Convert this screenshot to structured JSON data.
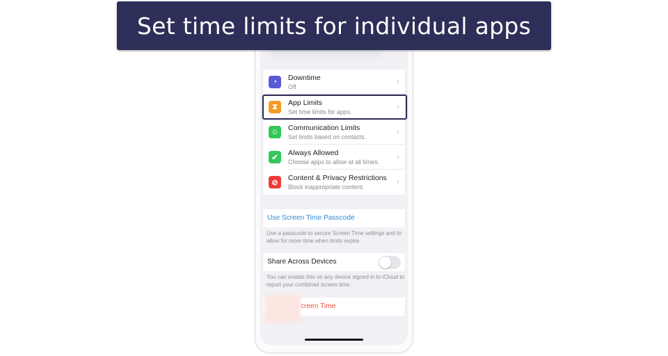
{
  "banner": {
    "title": "Set time limits for individual apps"
  },
  "colors": {
    "banner_bg": "#2e2f58",
    "link_blue": "#2f87d8",
    "destructive_red": "#e8553f"
  },
  "settings_group": [
    {
      "title": "Downtime",
      "subtitle": "Off",
      "icon": "downtime-icon",
      "icon_color": "#5b5ad6",
      "glyph": "◔"
    },
    {
      "title": "App Limits",
      "subtitle": "Set time limits for apps.",
      "icon": "hourglass-icon",
      "icon_color": "#f59a23",
      "glyph": "⧗",
      "highlighted": true
    },
    {
      "title": "Communication Limits",
      "subtitle": "Set limits based on contacts.",
      "icon": "contacts-icon",
      "icon_color": "#34c759",
      "glyph": "☺"
    },
    {
      "title": "Always Allowed",
      "subtitle": "Choose apps to allow at all times.",
      "icon": "checkmark-icon",
      "icon_color": "#34c759",
      "glyph": "✔"
    },
    {
      "title": "Content & Privacy Restrictions",
      "subtitle": "Block inappropriate content.",
      "icon": "restriction-icon",
      "icon_color": "#ef3b36",
      "glyph": "⊘"
    }
  ],
  "passcode": {
    "label": "Use Screen Time Passcode",
    "footnote": "Use a passcode to secure Screen Time settings and to allow for more time when limits expire."
  },
  "share": {
    "label": "Share Across Devices",
    "enabled": false,
    "footnote": "You can enable this on any device signed in to iCloud to report your combined screen time."
  },
  "turn_off": {
    "label": "creen Time"
  }
}
